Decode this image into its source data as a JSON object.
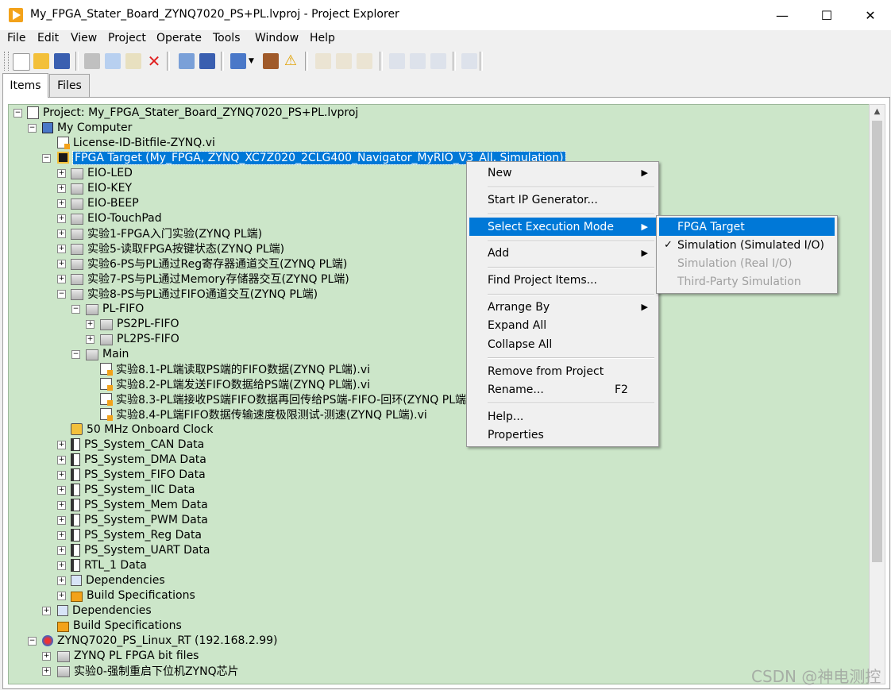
{
  "window": {
    "title": "My_FPGA_Stater_Board_ZYNQ7020_PS+PL.lvproj - Project Explorer",
    "minimize": "—",
    "maximize": "☐",
    "close": "✕"
  },
  "menubar": [
    "File",
    "Edit",
    "View",
    "Project",
    "Operate",
    "Tools",
    "Window",
    "Help"
  ],
  "tabs": {
    "items": "Items",
    "files": "Files"
  },
  "tree": {
    "project": "Project: My_FPGA_Stater_Board_ZYNQ7020_PS+PL.lvproj",
    "my_computer": "My Computer",
    "license": "License-ID-Bitfile-ZYNQ.vi",
    "fpga_target": "FPGA Target (My_FPGA, ZYNQ_XC7Z020_2CLG400_Navigator_MyRIO_V3_All, Simulation)",
    "eio_led": "EIO-LED",
    "eio_key": "EIO-KEY",
    "eio_beep": "EIO-BEEP",
    "eio_touchpad": "EIO-TouchPad",
    "exp1": "实验1-FPGA入门实验(ZYNQ PL端)",
    "exp5": "实验5-读取FPGA按键状态(ZYNQ PL端)",
    "exp6": "实验6-PS与PL通过Reg寄存器通道交互(ZYNQ PL端)",
    "exp7": "实验7-PS与PL通过Memory存储器交互(ZYNQ PL端)",
    "exp8": "实验8-PS与PL通过FIFO通道交互(ZYNQ PL端)",
    "pl_fifo": "PL-FIFO",
    "ps2pl": "PS2PL-FIFO",
    "pl2ps": "PL2PS-FIFO",
    "main": "Main",
    "vi81": "实验8.1-PL端读取PS端的FIFO数据(ZYNQ PL端).vi",
    "vi82": "实验8.2-PL端发送FIFO数据给PS端(ZYNQ PL端).vi",
    "vi83": "实验8.3-PL端接收PS端FIFO数据再回传给PS端-FIFO-回环(ZYNQ PL端).vi",
    "vi84": "实验8.4-PL端FIFO数据传输速度极限测试-测速(ZYNQ PL端).vi",
    "clock": "50 MHz Onboard Clock",
    "can": "PS_System_CAN Data",
    "dma": "PS_System_DMA Data",
    "fifo": "PS_System_FIFO Data",
    "iic": "PS_System_IIC Data",
    "mem": "PS_System_Mem Data",
    "pwm": "PS_System_PWM Data",
    "reg": "PS_System_Reg Data",
    "uart": "PS_System_UART Data",
    "rtl": "RTL_1 Data",
    "deps_fpga": "Dependencies",
    "build_fpga": "Build Specifications",
    "deps_pc": "Dependencies",
    "build_pc": "Build Specifications",
    "rt_target": "ZYNQ7020_PS_Linux_RT (192.168.2.99)",
    "bitfiles": "ZYNQ PL FPGA bit files",
    "exp0": "实验0-强制重启下位机ZYNQ芯片"
  },
  "context_menu": {
    "new": "New",
    "start_ip": "Start IP Generator...",
    "select_mode": "Select Execution Mode",
    "add": "Add",
    "find": "Find Project Items...",
    "arrange": "Arrange By",
    "expand": "Expand All",
    "collapse": "Collapse All",
    "remove": "Remove from Project",
    "rename": "Rename...",
    "rename_key": "F2",
    "help": "Help...",
    "properties": "Properties"
  },
  "submenu": {
    "fpga_target": "FPGA Target",
    "sim_simulated": "Simulation (Simulated I/O)",
    "sim_real": "Simulation (Real I/O)",
    "third_party": "Third-Party Simulation",
    "checked": "✓"
  },
  "watermark": "CSDN @神电测控",
  "colors": {
    "tree_bg": "#cce6c9",
    "selection": "#0078d7",
    "accent_icon": "#f3a21a"
  }
}
